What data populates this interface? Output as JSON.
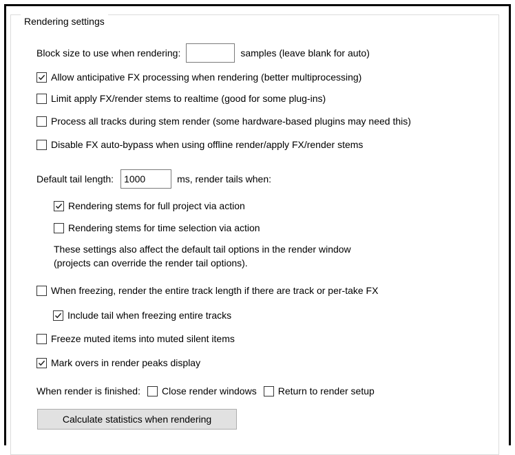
{
  "group_title": "Rendering settings",
  "block_size": {
    "label": "Block size to use when rendering:",
    "value": "",
    "suffix": "samples (leave blank for auto)"
  },
  "options": {
    "anticipative": {
      "label": "Allow anticipative FX processing when rendering (better multiprocessing)",
      "checked": true
    },
    "limit_realtime": {
      "label": "Limit apply FX/render stems to realtime (good for some plug-ins)",
      "checked": false
    },
    "process_all": {
      "label": "Process all tracks during stem render (some hardware-based plugins may need this)",
      "checked": false
    },
    "disable_bypass": {
      "label": "Disable FX auto-bypass when using offline render/apply FX/render stems",
      "checked": false
    }
  },
  "tail": {
    "label": "Default tail length:",
    "value": "1000",
    "suffix": "ms, render tails when:",
    "full_project": {
      "label": "Rendering stems for full project via action",
      "checked": true
    },
    "time_selection": {
      "label": "Rendering stems for time selection via action",
      "checked": false
    },
    "note_line1": "These settings also affect the default tail options in the render window",
    "note_line2": "(projects can override the render tail options)."
  },
  "freeze": {
    "entire_track": {
      "label": "When freezing, render the entire track length if there are track or per-take FX",
      "checked": false
    },
    "include_tail": {
      "label": "Include tail when freezing entire tracks",
      "checked": true
    },
    "muted_items": {
      "label": "Freeze muted items into muted silent items",
      "checked": false
    }
  },
  "mark_overs": {
    "label": "Mark overs in render peaks display",
    "checked": true
  },
  "finished": {
    "label": "When render is finished:",
    "close_windows": {
      "label": "Close render windows",
      "checked": false
    },
    "return_setup": {
      "label": "Return to render setup",
      "checked": false
    }
  },
  "calc_button": "Calculate statistics when rendering"
}
